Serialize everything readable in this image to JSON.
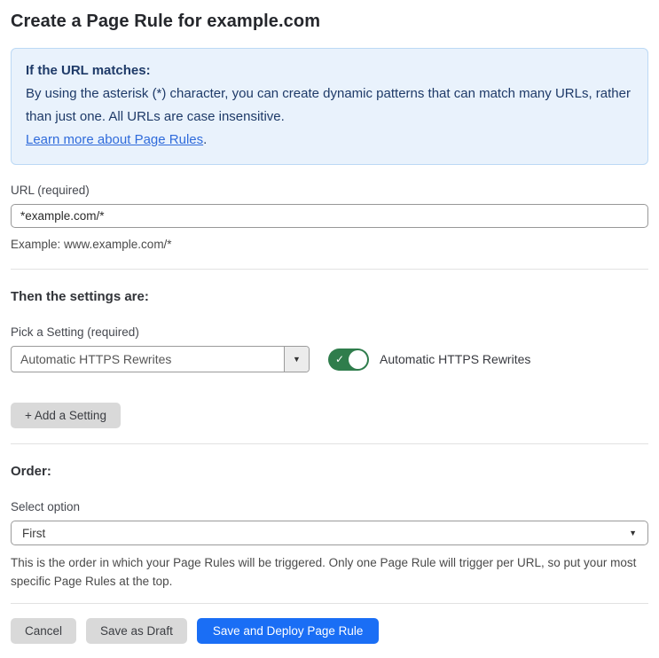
{
  "page": {
    "title": "Create a Page Rule for example.com"
  },
  "info_box": {
    "heading": "If the URL matches:",
    "body": "By using the asterisk (*) character, you can create dynamic patterns that can match many URLs, rather than just one. All URLs are case insensitive.",
    "link_text": "Learn more about Page Rules",
    "link_suffix": "."
  },
  "url_field": {
    "label": "URL (required)",
    "value": "*example.com/*",
    "helper": "Example: www.example.com/*"
  },
  "settings_section": {
    "heading": "Then the settings are:",
    "picker_label": "Pick a Setting (required)",
    "picker_value": "Automatic HTTPS Rewrites",
    "toggle_state": "on",
    "toggle_label": "Automatic HTTPS Rewrites",
    "add_setting_label": "+ Add a Setting"
  },
  "order_section": {
    "heading": "Order:",
    "select_label": "Select option",
    "select_value": "First",
    "helper": "This is the order in which your Page Rules will be triggered. Only one Page Rule will trigger per URL, so put your most specific Page Rules at the top."
  },
  "footer": {
    "cancel_label": "Cancel",
    "save_draft_label": "Save as Draft",
    "save_deploy_label": "Save and Deploy Page Rule"
  },
  "icons": {
    "dropdown_arrow": "▼",
    "select_arrow": "▼",
    "toggle_check": "✓"
  },
  "colors": {
    "info_bg": "#e9f2fc",
    "info_border": "#bcd9f5",
    "info_text": "#1e3a68",
    "link_blue": "#2f6bdb",
    "toggle_green": "#2f7d4c",
    "primary_blue": "#1a6ef5",
    "gray_button_bg": "#d9d9d9",
    "divider": "#e2e2e2",
    "input_border": "#989898"
  }
}
